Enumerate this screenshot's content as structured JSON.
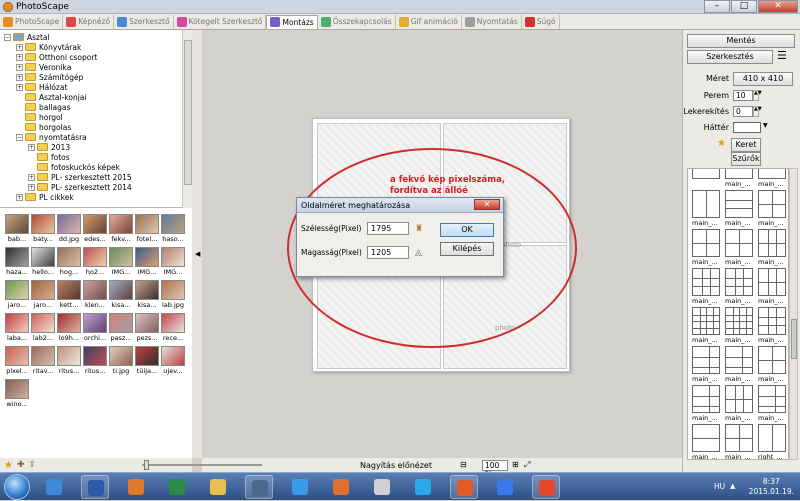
{
  "window": {
    "title": "PhotoScape",
    "min": "–",
    "max": "□",
    "close": "✕"
  },
  "tabs": [
    {
      "label": "PhotoScape",
      "color": "#e88a2a"
    },
    {
      "label": "Képnéző",
      "color": "#e04848"
    },
    {
      "label": "Szerkesztő",
      "color": "#4a8ad0"
    },
    {
      "label": "Kötegelt Szerkesztő",
      "color": "#d24a9a"
    },
    {
      "label": "Montázs",
      "color": "#7a5ad0"
    },
    {
      "label": "Összekapcsolás",
      "color": "#4ab06a"
    },
    {
      "label": "Gif animáció",
      "color": "#e0b030"
    },
    {
      "label": "Nyomtatás",
      "color": "#a0a0a0"
    },
    {
      "label": "Súgó",
      "color": "#d83030"
    }
  ],
  "tree": [
    {
      "label": "Asztal",
      "level": 0,
      "type": "root"
    },
    {
      "label": "Könyvtárak",
      "level": 1,
      "type": "plus"
    },
    {
      "label": "Otthoni csoport",
      "level": 1,
      "type": "plus"
    },
    {
      "label": "Veronika",
      "level": 1,
      "type": "plus"
    },
    {
      "label": "Számítógép",
      "level": 1,
      "type": "plus"
    },
    {
      "label": "Hálózat",
      "level": 1,
      "type": "plus"
    },
    {
      "label": "Asztal-konjai",
      "level": 1,
      "type": "folder"
    },
    {
      "label": "ballagas",
      "level": 1,
      "type": "folder"
    },
    {
      "label": "horgol",
      "level": 1,
      "type": "folder"
    },
    {
      "label": "horgolas",
      "level": 1,
      "type": "folder"
    },
    {
      "label": "nyomtatásra",
      "level": 1,
      "type": "minus"
    },
    {
      "label": "2013",
      "level": 2,
      "type": "plus"
    },
    {
      "label": "fotos",
      "level": 2,
      "type": "folder"
    },
    {
      "label": "fotoskuckós képek",
      "level": 2,
      "type": "folder"
    },
    {
      "label": "PL- szerkesztett 2015",
      "level": 2,
      "type": "plus"
    },
    {
      "label": "PL- szerkesztett 2014",
      "level": 2,
      "type": "plus"
    },
    {
      "label": "PL cikkek",
      "level": 1,
      "type": "plus"
    }
  ],
  "thumbnails": [
    {
      "label": "bab...",
      "c1": "#c8a27a",
      "c2": "#5e4a3a"
    },
    {
      "label": "baty...",
      "c1": "#b04a3a",
      "c2": "#e8c8a0"
    },
    {
      "label": "dd.jpg",
      "c1": "#7a6a9a",
      "c2": "#d8b8a8"
    },
    {
      "label": "edes...",
      "c1": "#d0a070",
      "c2": "#6a4030"
    },
    {
      "label": "fekv...",
      "c1": "#e0b090",
      "c2": "#804040"
    },
    {
      "label": "fotel...",
      "c1": "#a07050",
      "c2": "#d8c8b0"
    },
    {
      "label": "haso...",
      "c1": "#5a7a9a",
      "c2": "#c0a080"
    },
    {
      "label": "haza...",
      "c1": "#303030",
      "c2": "#a0a0a0"
    },
    {
      "label": "hello...",
      "c1": "#e0e0e0",
      "c2": "#404040"
    },
    {
      "label": "hog...",
      "c1": "#907060",
      "c2": "#e0c0a0"
    },
    {
      "label": "ho2...",
      "c1": "#c05050",
      "c2": "#e8d0b0"
    },
    {
      "label": "IMG...",
      "c1": "#6a8a5a",
      "c2": "#d0c0a0"
    },
    {
      "label": "IMG...",
      "c1": "#3a5a8a",
      "c2": "#e0a070"
    },
    {
      "label": "IMG...",
      "c1": "#b08070",
      "c2": "#f0e0d0"
    },
    {
      "label": "jaro...",
      "c1": "#6a9a4a",
      "c2": "#e0d0b0"
    },
    {
      "label": "jaro...",
      "c1": "#a06040",
      "c2": "#d8b090"
    },
    {
      "label": "kett...",
      "c1": "#c08060",
      "c2": "#503830"
    },
    {
      "label": "klen...",
      "c1": "#d0a0a0",
      "c2": "#705050"
    },
    {
      "label": "kisa...",
      "c1": "#a0b0c0",
      "c2": "#604040"
    },
    {
      "label": "kisa...",
      "c1": "#c0a090",
      "c2": "#403030"
    },
    {
      "label": "lab.jpg",
      "c1": "#b07050",
      "c2": "#e0c8b0"
    },
    {
      "label": "laba...",
      "c1": "#c04040",
      "c2": "#f0d0c0"
    },
    {
      "label": "lab2...",
      "c1": "#d06060",
      "c2": "#f0e0d0"
    },
    {
      "label": "lo9h...",
      "c1": "#a03030",
      "c2": "#e0b0a0"
    },
    {
      "label": "orchi...",
      "c1": "#c0a0d0",
      "c2": "#604070"
    },
    {
      "label": "pasz...",
      "c1": "#d08080",
      "c2": "#a0a0a0"
    },
    {
      "label": "pezs...",
      "c1": "#e0c0c0",
      "c2": "#806060"
    },
    {
      "label": "rece...",
      "c1": "#c04848",
      "c2": "#f0e0e0"
    },
    {
      "label": "pixel...",
      "c1": "#d06050",
      "c2": "#e0c0b0"
    },
    {
      "label": "ritav...",
      "c1": "#a06a5a",
      "c2": "#d0c0b0"
    },
    {
      "label": "ritus...",
      "c1": "#c09080",
      "c2": "#f0e8e0"
    },
    {
      "label": "ritus...",
      "c1": "#404060",
      "c2": "#c05050"
    },
    {
      "label": "ti.jpg",
      "c1": "#e0d0c0",
      "c2": "#906050"
    },
    {
      "label": "tüija...",
      "c1": "#c04040",
      "c2": "#303030"
    },
    {
      "label": "ujev...",
      "c1": "#e0e0e0",
      "c2": "#c04040"
    },
    {
      "label": "wino...",
      "c1": "#806050",
      "c2": "#d0b0a0"
    }
  ],
  "canvas": {
    "photo_label_1": "photo",
    "photo_label_2": "photo",
    "annotation_line1": "a fekvő kép pixelszáma,",
    "annotation_line2": "fordítva az állóé",
    "annotation_color": "#cc2d2d"
  },
  "dialog": {
    "title": "Oldalméret meghatározása",
    "width_label": "Szélesség(Pixel)",
    "width_value": "1795",
    "height_label": "Magasság(Pixel)",
    "height_value": "1205",
    "ok_label": "OK",
    "cancel_label": "Kilépés"
  },
  "canvas_bottom": {
    "preview_label": "Nagyítás előnézet",
    "zoom_value": "100 %"
  },
  "right": {
    "save_label": "Mentés",
    "edit_label": "Szerkesztés",
    "size_label": "Méret",
    "size_value": "410 x 410",
    "margin_label": "Perem",
    "margin_value": "10",
    "round_label": "Lekerekítés",
    "round_value": "0",
    "bg_label": "Háttér",
    "frame_label": "Keret",
    "filter_label": "Szűrők",
    "layouts": [
      {
        "label": "",
        "pattern": "h2"
      },
      {
        "label": "main_...",
        "pattern": "h2"
      },
      {
        "label": "main_...",
        "pattern": "h2"
      },
      {
        "label": "main_...",
        "pattern": "v2"
      },
      {
        "label": "main_...",
        "pattern": "h3"
      },
      {
        "label": "main_...",
        "pattern": "g4"
      },
      {
        "label": "main_...",
        "pattern": "g4"
      },
      {
        "label": "main_...",
        "pattern": "g4"
      },
      {
        "label": "main_...",
        "pattern": "g6"
      },
      {
        "label": "main_...",
        "pattern": "g9"
      },
      {
        "label": "main_...",
        "pattern": "g9"
      },
      {
        "label": "main_...",
        "pattern": "g6"
      },
      {
        "label": "main_...",
        "pattern": "g16"
      },
      {
        "label": "main_...",
        "pattern": "g16"
      },
      {
        "label": "main_...",
        "pattern": "g9"
      },
      {
        "label": "main_...",
        "pattern": "mix"
      },
      {
        "label": "main_...",
        "pattern": "mix"
      },
      {
        "label": "main_...",
        "pattern": "g4"
      },
      {
        "label": "main_...",
        "pattern": "mix"
      },
      {
        "label": "main_...",
        "pattern": "g6"
      },
      {
        "label": "main_...",
        "pattern": "mix"
      },
      {
        "label": "main_...",
        "pattern": "h2"
      },
      {
        "label": "main_...",
        "pattern": "g4"
      },
      {
        "label": "right_...",
        "pattern": "v2"
      },
      {
        "label": "right_...",
        "pattern": "v2"
      },
      {
        "label": "right_...",
        "pattern": "h2"
      },
      {
        "label": "right_...",
        "pattern": "sel"
      }
    ]
  },
  "taskbar": {
    "lang": "HU",
    "time": "8:37",
    "date": "2015.01.19.",
    "apps": [
      {
        "name": "ie-icon",
        "color": "#3a8ad8",
        "open": false
      },
      {
        "name": "word-icon",
        "color": "#2a5aa8",
        "open": true
      },
      {
        "name": "firefox-icon",
        "color": "#e07a2a",
        "open": false
      },
      {
        "name": "excel-icon",
        "color": "#2a8a4a",
        "open": false
      },
      {
        "name": "explorer-icon",
        "color": "#e8c050",
        "open": false
      },
      {
        "name": "window-icon",
        "color": "#4a6a8a",
        "open": true
      },
      {
        "name": "ie-icon",
        "color": "#3a9ae8",
        "open": false
      },
      {
        "name": "media-icon",
        "color": "#e07030",
        "open": false
      },
      {
        "name": "chrome-icon",
        "color": "#d0d0d0",
        "open": false
      },
      {
        "name": "skype-icon",
        "color": "#2aa8e8",
        "open": false
      },
      {
        "name": "office-icon",
        "color": "#e05a2a",
        "open": true
      },
      {
        "name": "butterfly-icon",
        "color": "#3a7ae8",
        "open": false
      },
      {
        "name": "photoscape-icon",
        "color": "#e04a2a",
        "open": true
      }
    ]
  }
}
